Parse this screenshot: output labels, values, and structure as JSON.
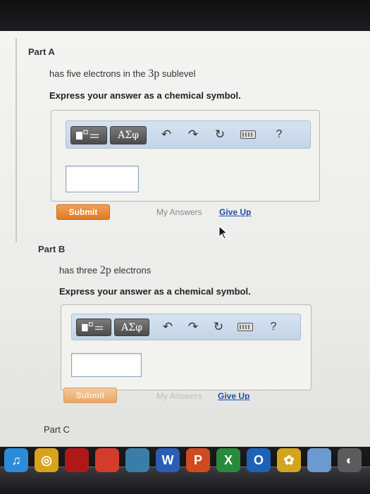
{
  "partA": {
    "title": "Part A",
    "prompt_pre": "has five electrons in the ",
    "prompt_chem": "3p",
    "prompt_post": " sublevel",
    "instruction": "Express your answer as a chemical symbol.",
    "toolbar": {
      "greek_label": "ΑΣφ",
      "help_label": "?"
    },
    "input_value": "",
    "submit_label": "Submit",
    "my_answers_label": "My Answers",
    "give_up_label": "Give Up"
  },
  "partB": {
    "title": "Part B",
    "prompt_pre": "has three ",
    "prompt_chem": "2p",
    "prompt_post": " electrons",
    "instruction": "Express your answer as a chemical symbol.",
    "toolbar": {
      "greek_label": "ΑΣφ",
      "help_label": "?"
    },
    "input_value": "",
    "submit_label": "Submit",
    "my_answers_label": "My Answers",
    "give_up_label": "Give Up"
  },
  "partC": {
    "title": "Part C"
  },
  "colors": {
    "accent_blue": "#1e4fa6",
    "submit_orange": "#e07a22",
    "toolbar_blue": "#c8d8ea"
  },
  "icons": [
    "template-icon",
    "undo-icon",
    "redo-icon",
    "reset-icon",
    "keyboard-icon",
    "help-icon"
  ],
  "dock": [
    {
      "name": "itunes-icon",
      "color": "#2c8bd8"
    },
    {
      "name": "chrome-icon",
      "color": "#d9a21b"
    },
    {
      "name": "photo-booth-icon",
      "color": "#b01818"
    },
    {
      "name": "calendar-icon",
      "color": "#d53b2a"
    },
    {
      "name": "preview-icon",
      "color": "#3a7ea8"
    },
    {
      "name": "word-icon",
      "color": "#2a5db3"
    },
    {
      "name": "powerpoint-icon",
      "color": "#d04a20"
    },
    {
      "name": "excel-icon",
      "color": "#2a8a3c"
    },
    {
      "name": "outlook-icon",
      "color": "#1e62b8"
    },
    {
      "name": "messenger-icon",
      "color": "#d4a41e"
    },
    {
      "name": "image-capture-icon",
      "color": "#6b9ad1"
    },
    {
      "name": "system-icon",
      "color": "#5b5b5b"
    }
  ]
}
